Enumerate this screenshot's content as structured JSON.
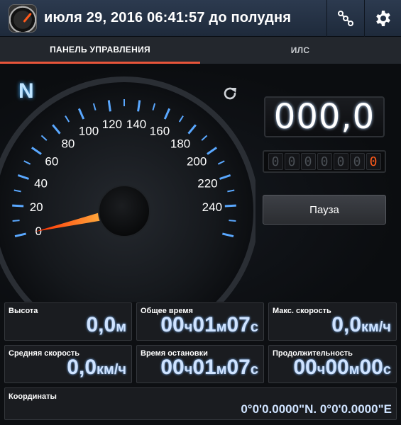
{
  "header": {
    "datetime": "июля 29, 2016 06:41:57 до полудня",
    "icons": [
      "speedometer-app-icon",
      "link-icon",
      "gear-icon"
    ]
  },
  "tabs": [
    {
      "label": "ПАНЕЛЬ УПРАВЛЕНИЯ",
      "active": true
    },
    {
      "label": "ИЛС",
      "active": false
    }
  ],
  "gauge": {
    "heading": "N",
    "speed_value": 0,
    "tick_labels": [
      "0",
      "20",
      "40",
      "60",
      "80",
      "100",
      "120",
      "140",
      "160",
      "180",
      "200",
      "220",
      "240"
    ]
  },
  "speed_display": "000,0",
  "odometer": [
    "0",
    "0",
    "0",
    "0",
    "0",
    "0",
    "0"
  ],
  "pause_button": "Пауза",
  "stats": [
    {
      "label": "Высота",
      "parts": [
        "0,0",
        "м"
      ]
    },
    {
      "label": "Общее время",
      "parts": [
        "00",
        "ч",
        "01",
        "м",
        "07",
        "с"
      ]
    },
    {
      "label": "Макс. скорость",
      "parts": [
        "0,0",
        "км/ч"
      ]
    },
    {
      "label": "Средняя скорость",
      "parts": [
        "0,0",
        "км/ч"
      ]
    },
    {
      "label": "Время остановки",
      "parts": [
        "00",
        "ч",
        "01",
        "м",
        "07",
        "с"
      ]
    },
    {
      "label": "Продолжительность",
      "parts": [
        "00",
        "ч",
        "00",
        "м",
        "00",
        "с"
      ]
    }
  ],
  "coordinates": {
    "label": "Координаты",
    "value": "0°0'0.0000\"N. 0°0'0.0000\"E"
  },
  "colors": {
    "accent": "#e8553a",
    "gauge_tick": "#5aa8ff",
    "value_text": "#cfe3ff",
    "needle": "#ff4a10"
  }
}
